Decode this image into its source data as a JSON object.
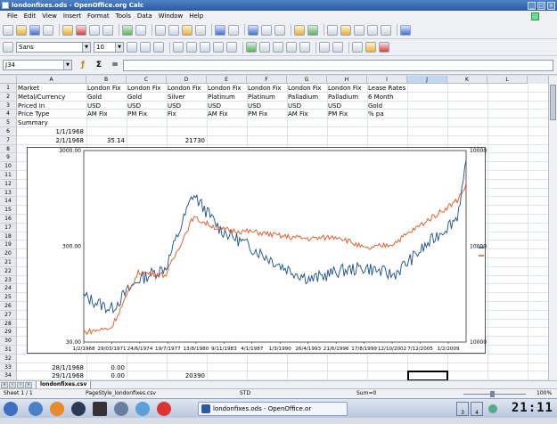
{
  "window": {
    "title": "londonfixes.ods - OpenOffice.org Calc"
  },
  "menu": [
    "File",
    "Edit",
    "View",
    "Insert",
    "Format",
    "Tools",
    "Data",
    "Window",
    "Help"
  ],
  "format_toolbar": {
    "font_name": "Sans",
    "font_size": "10"
  },
  "formula_bar": {
    "cell_ref": "J34",
    "sum_symbol": "Σ",
    "equals_symbol": "="
  },
  "columns": [
    "A",
    "B",
    "C",
    "D",
    "E",
    "F",
    "G",
    "H",
    "I",
    "J",
    "K",
    "L"
  ],
  "rows_top": [
    "1",
    "2",
    "3",
    "4",
    "5",
    "6",
    "7",
    "8",
    "9",
    "10",
    "11",
    "12",
    "13",
    "14",
    "15",
    "16",
    "17",
    "18",
    "19",
    "20",
    "21",
    "22",
    "23",
    "24",
    "25",
    "26",
    "27",
    "28",
    "29",
    "30",
    "31",
    "32",
    "33",
    "34"
  ],
  "cells": {
    "r1": [
      "Market",
      "London Fix",
      "London Fix",
      "London Fix",
      "London Fix",
      "London Fix",
      "London Fix",
      "London Fix",
      "Lease Rates"
    ],
    "r2": [
      "Metal/Currency",
      "Gold",
      "Gold",
      "Silver",
      "Platinum",
      "Platinum",
      "Palladium",
      "Palladium",
      "6 Month"
    ],
    "r3": [
      "Priced In",
      "USD",
      "USD",
      "USD",
      "USD",
      "USD",
      "USD",
      "USD",
      "Gold"
    ],
    "r4": [
      "Price Type",
      "AM Fix",
      "PM Fix",
      "Fix",
      "AM Fix",
      "PM Fix",
      "AM Fix",
      "PM Fix",
      "% pa"
    ],
    "r5": [
      "Summary"
    ],
    "r6": [
      "1/1/1968"
    ],
    "r7": [
      "2/1/1968",
      "35.14",
      "",
      "21730"
    ],
    "r33": [
      "28/1/1968",
      "0.00"
    ],
    "r34": [
      "29/1/1968",
      "0.00",
      "",
      "20390"
    ]
  },
  "chart_data": {
    "type": "line",
    "x_tick_labels": [
      "1/2/1968",
      "29/03/1971",
      "24/6/1974",
      "19/7/1977",
      "13/8/1980",
      "9/11/1983",
      "4/1/1987",
      "1/3/1990",
      "26/4/1993",
      "21/6/1996",
      "17/8/1999",
      "12/10/2002",
      "7/12/2005",
      "1/2/2009"
    ],
    "y_left_ticks": [
      "3000.00",
      "300.00",
      "30.00"
    ],
    "y_right_ticks": [
      "1000000",
      "100000",
      "10000"
    ],
    "left_scale": "log",
    "right_scale": "log",
    "ylim_left": [
      30,
      3000
    ],
    "ylim_right": [
      10000,
      1000000
    ],
    "x": [
      1968,
      1971,
      1974,
      1977,
      1980,
      1983,
      1987,
      1990,
      1993,
      1996,
      1999,
      2002,
      2005,
      2009,
      2010
    ],
    "series": [
      {
        "name": "Silver",
        "color": "#1b4f8a",
        "axis": "right",
        "values": [
          30000,
          22000,
          45000,
          60000,
          350000,
          150000,
          90000,
          60000,
          45000,
          55000,
          60000,
          50000,
          90000,
          200000,
          700000
        ]
      },
      {
        "name": "Gold",
        "color": "#e8521e",
        "axis": "left",
        "values": [
          38,
          42,
          160,
          150,
          600,
          450,
          420,
          380,
          360,
          380,
          280,
          320,
          500,
          900,
          1300
        ]
      }
    ],
    "legend_position": "right"
  },
  "tabs": {
    "sheet_name": "londonfixes.csv"
  },
  "status": {
    "sheet": "Sheet 1 / 1",
    "page_style": "PageStyle_londonfixes.csv",
    "mode": "STD",
    "sum": "Sum=0",
    "zoom": "100%"
  },
  "taskbar": {
    "task_label": "londonfixes.ods - OpenOffice.or",
    "clock": "21:11",
    "pager_1": "3",
    "pager_2": "4"
  }
}
